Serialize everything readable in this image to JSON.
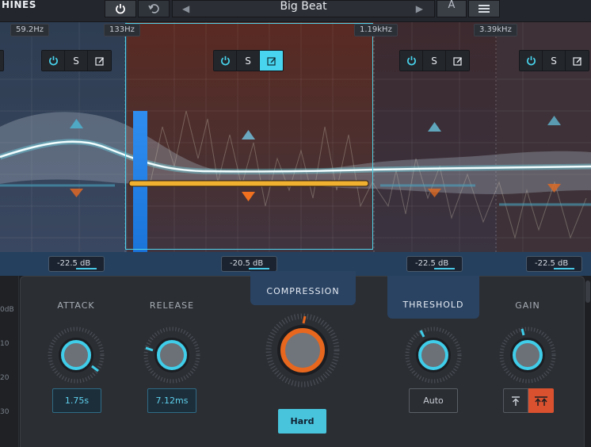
{
  "app": {
    "brand_fragment": "HINES"
  },
  "toolbar": {
    "power_icon": "power-icon",
    "undo_icon": "undo-icon",
    "preset_name": "Big Beat",
    "ab_label": "A",
    "menu_icon": "menu-icon"
  },
  "bands": {
    "frequencies": [
      "59.2Hz",
      "133Hz",
      "1.19kHz",
      "3.39kHz"
    ],
    "controls": [
      {
        "power": "power-icon",
        "solo": "S",
        "edit": "edit-icon",
        "active": false
      },
      {
        "power": "power-icon",
        "solo": "S",
        "edit": "edit-icon",
        "active": true
      },
      {
        "power": "power-icon",
        "solo": "S",
        "edit": "edit-icon",
        "active": false
      },
      {
        "power": "power-icon",
        "solo": "S",
        "edit": "edit-icon",
        "active": false
      }
    ],
    "thresholds": [
      "-22.5 dB",
      "-20.5 dB",
      "-22.5 dB",
      "-22.5 dB"
    ]
  },
  "ruler": {
    "ticks": [
      "0dB",
      "10",
      "20",
      "30"
    ]
  },
  "compressor": {
    "attack": {
      "label": "ATTACK",
      "value": "1.75s"
    },
    "release": {
      "label": "RELEASE",
      "value": "7.12ms"
    },
    "compression": {
      "label": "COMPRESSION",
      "mode": "Hard"
    },
    "threshold": {
      "label": "THRESHOLD",
      "mode": "Auto"
    },
    "gain": {
      "label": "GAIN"
    }
  },
  "colors": {
    "accent": "#48d4ee",
    "compression_ring": "#e8671e",
    "gain_active": "#d9512e",
    "panel_tab": "#2a4363"
  }
}
